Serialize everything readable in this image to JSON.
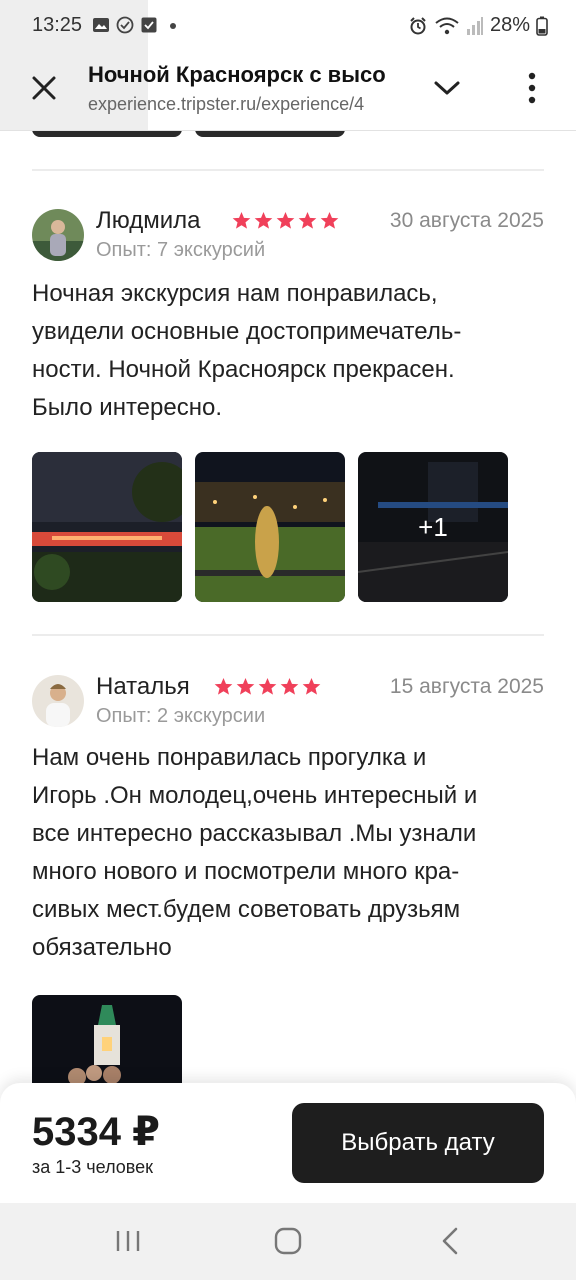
{
  "status_bar": {
    "time": "13:25",
    "battery": "28%"
  },
  "browser": {
    "title": "Ночной Красноярск с высо",
    "url": "experience.tripster.ru/experience/4"
  },
  "reviews": [
    {
      "author": "Людмила",
      "rating": 5,
      "date": "30 августа 2025",
      "experience": "Опыт: 7 экскурсий",
      "text_lines": [
        "Ночная экскурсия нам понравилась,",
        "увидели основные достопримечатель-",
        "ности. Ночной Красноярск прекрасен.",
        "Было интересно."
      ],
      "photos": [
        "night-bridge-photo",
        "city-view-statue-photo",
        "neon-sign-photo"
      ],
      "more_photos": "+1"
    },
    {
      "author": "Наталья",
      "rating": 5,
      "date": "15 августа 2025",
      "experience": "Опыт: 2 экскурсии",
      "text_lines": [
        "Нам очень понравилась прогулка и",
        "Игорь .Он молодец,очень интересный и",
        "все интересно рассказывал .Мы узнали",
        "много нового и посмотрели много кра-",
        "сивых мест.будем советовать друзьям",
        "обязательно"
      ],
      "photos": [
        "chapel-group-photo"
      ]
    }
  ],
  "booking": {
    "price": "5334 ₽",
    "note": "за 1-3 человек",
    "button_label": "Выбрать дату"
  },
  "colors": {
    "star": "#f0405a",
    "button": "#1e1e1e"
  }
}
